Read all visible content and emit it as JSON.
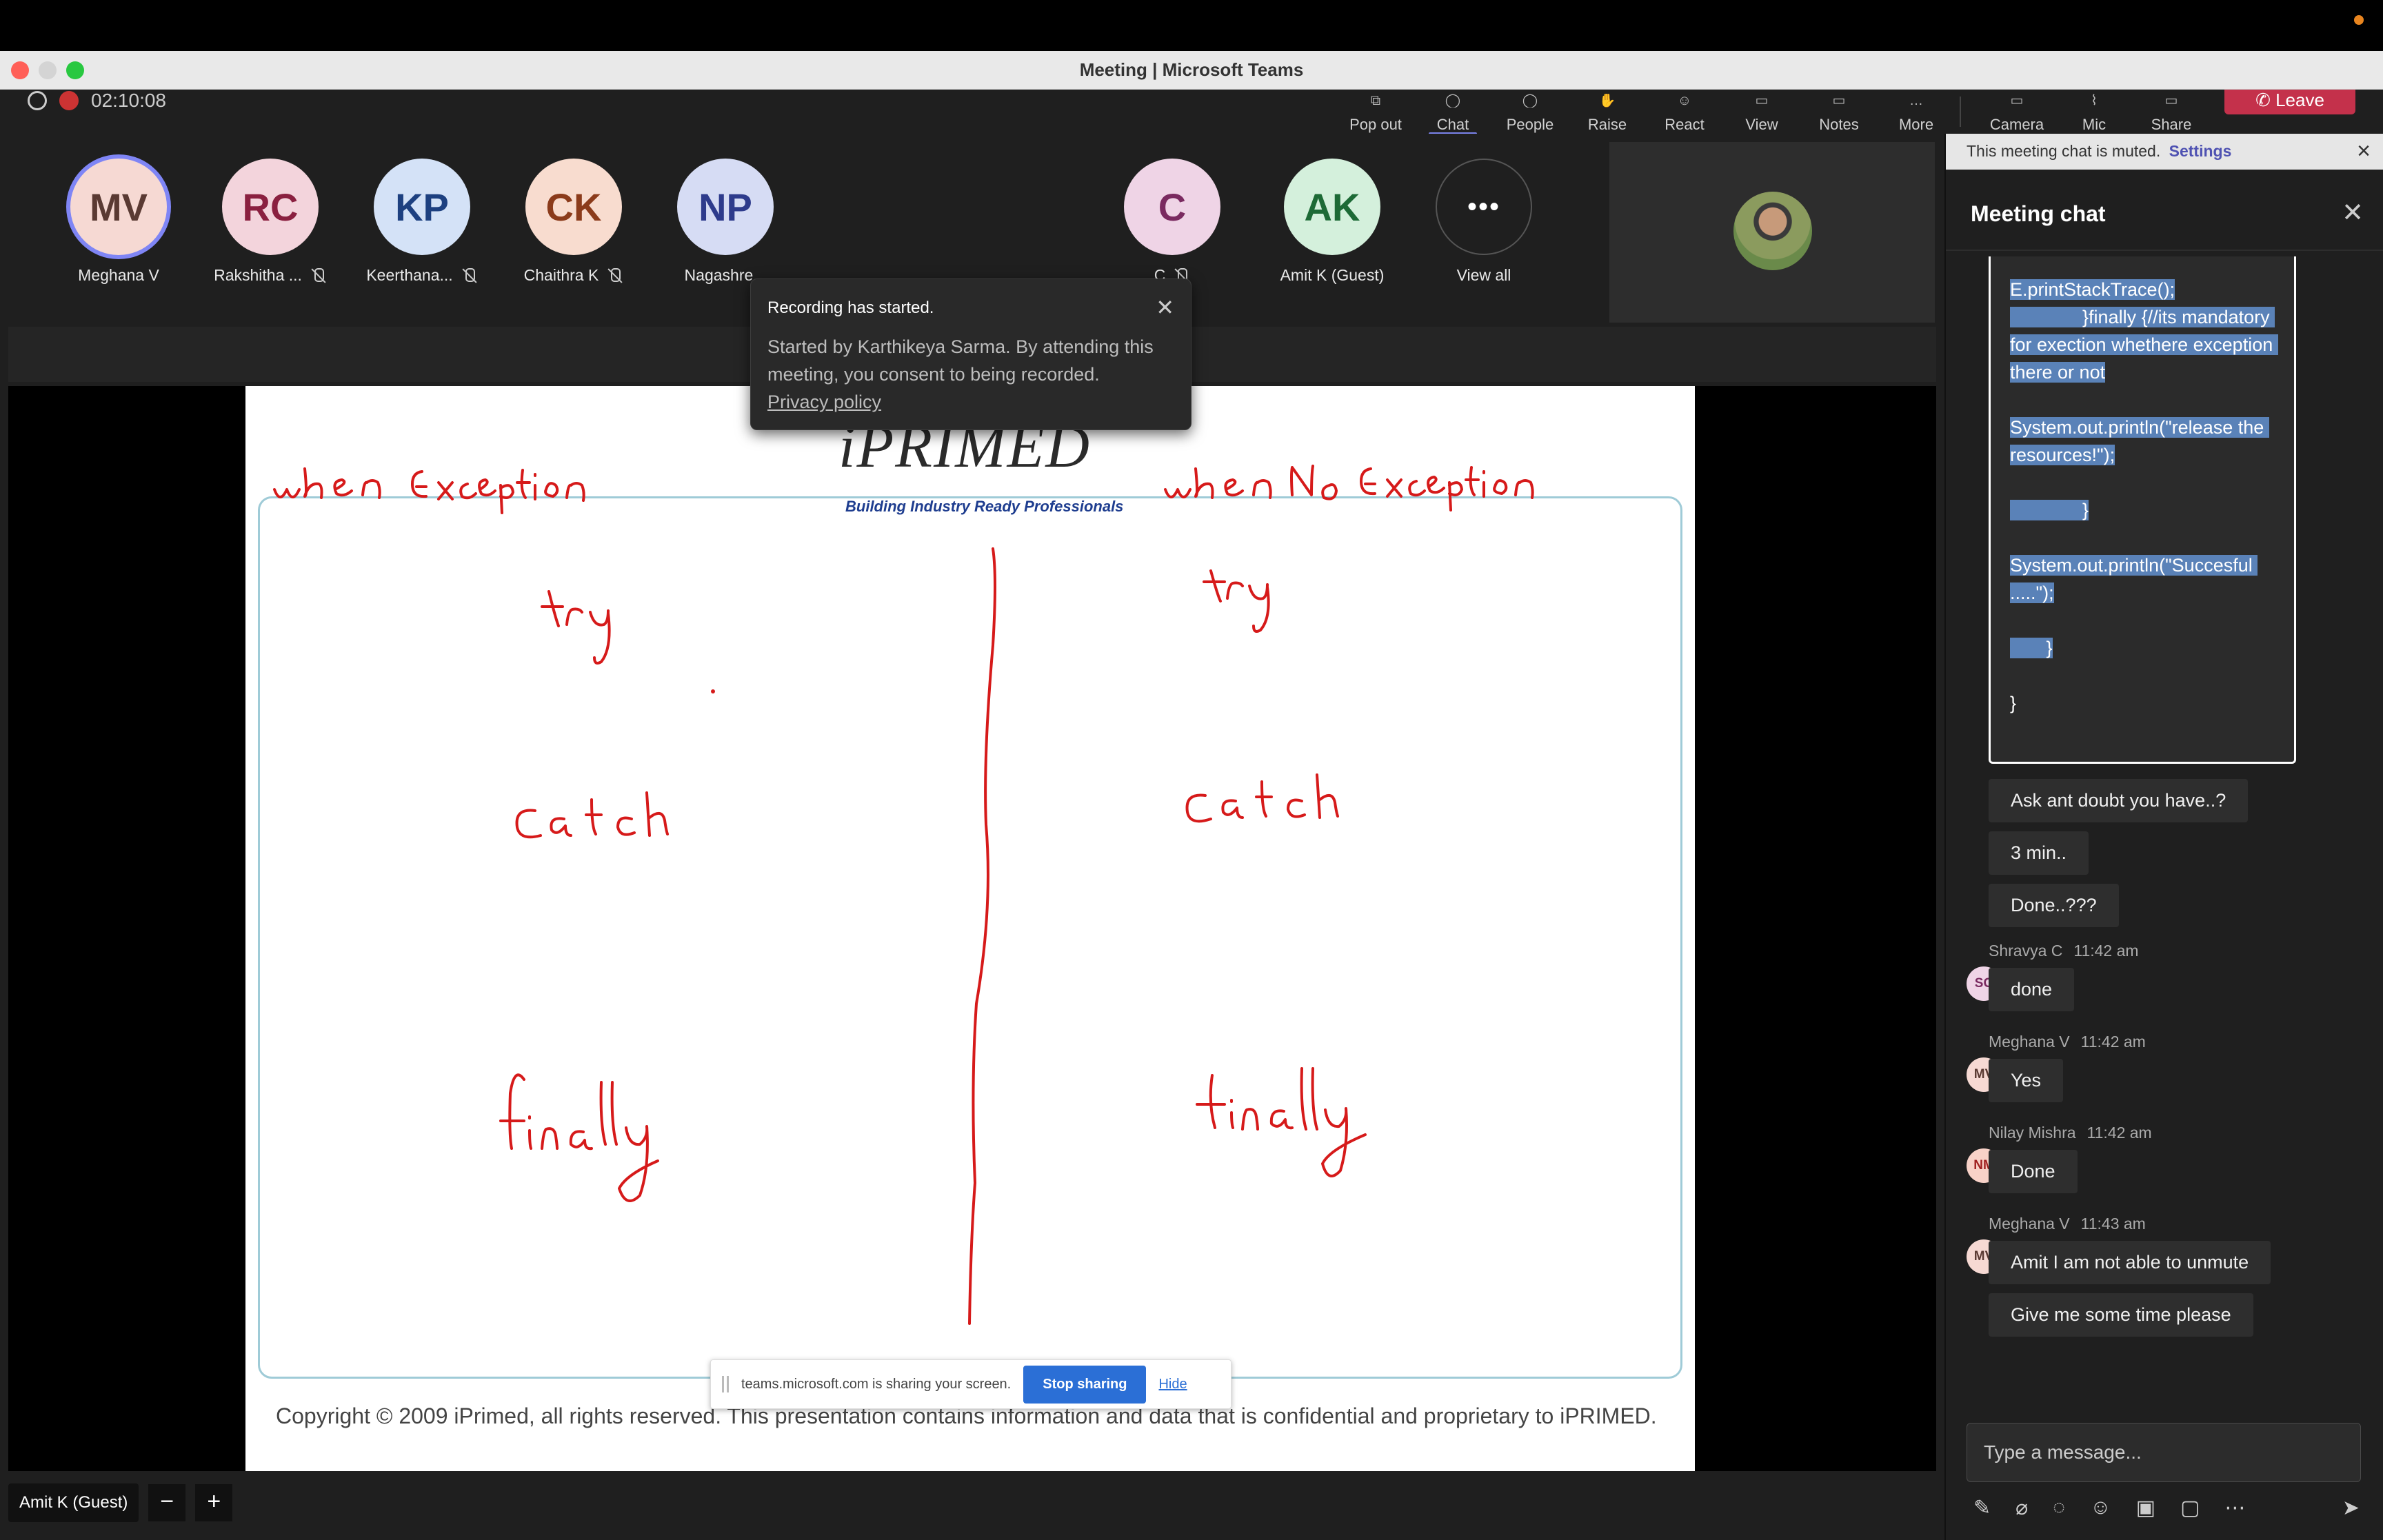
{
  "window": {
    "title": "Meeting | Microsoft Teams"
  },
  "toolbar": {
    "timer": "02:10:08",
    "buttons": [
      {
        "id": "popout",
        "label": "Pop out"
      },
      {
        "id": "chat",
        "label": "Chat"
      },
      {
        "id": "people",
        "label": "People"
      },
      {
        "id": "raise",
        "label": "Raise"
      },
      {
        "id": "react",
        "label": "React"
      },
      {
        "id": "view",
        "label": "View"
      },
      {
        "id": "notes",
        "label": "Notes"
      },
      {
        "id": "more",
        "label": "More"
      },
      {
        "id": "camera",
        "label": "Camera"
      },
      {
        "id": "mic",
        "label": "Mic"
      },
      {
        "id": "share",
        "label": "Share"
      }
    ],
    "leave_label": "Leave"
  },
  "participants": [
    {
      "initials": "MV",
      "name": "Meghana V",
      "bg": "#f6d9d3",
      "fg": "#5a3a33",
      "muted": false
    },
    {
      "initials": "RC",
      "name": "Rakshitha ...",
      "bg": "#f3d4dc",
      "fg": "#8a2040",
      "muted": true
    },
    {
      "initials": "KP",
      "name": "Keerthana...",
      "bg": "#d4e2f7",
      "fg": "#1d4080",
      "muted": true
    },
    {
      "initials": "CK",
      "name": "Chaithra K",
      "bg": "#f8dccf",
      "fg": "#8b3b1b",
      "muted": true
    },
    {
      "initials": "NP",
      "name": "Nagashre...",
      "bg": "#d6dcf4",
      "fg": "#2e3b8c",
      "muted": false
    },
    {
      "initials": "C",
      "name": "C",
      "bg": "#efd4e6",
      "fg": "#7a2a60",
      "muted": true
    },
    {
      "initials": "AK",
      "name": "Amit K (Guest)",
      "bg": "#d4f0dc",
      "fg": "#1d6a36",
      "muted": false
    }
  ],
  "view_all_label": "View all",
  "recording_toast": {
    "title": "Recording has started.",
    "body": "Started by Karthikeya Sarma. By attending this meeting, you consent to being recorded.",
    "policy_link": "Privacy policy"
  },
  "slide": {
    "logo": "iPRIMED",
    "tagline": "Building Industry Ready Professionals",
    "footer": "Copyright © 2009 iPrimed, all rights reserved. This presentation contains information  and data  that is confidential and proprietary to iPRIMED."
  },
  "sharing_bar": {
    "text": "teams.microsoft.com is sharing your screen.",
    "stop_label": "Stop sharing",
    "hide_label": "Hide"
  },
  "bottom_bar": {
    "name": "Amit K (Guest)",
    "zoom_out": "−",
    "zoom_in": "+"
  },
  "chat": {
    "muted_text": "This meeting chat is muted.",
    "muted_settings": "Settings",
    "title": "Meeting chat",
    "code_message": [
      "E.printStackTrace();",
      "              }finally {//its mandatory for exection whethere exception there or not",
      "",
      "System.out.println(\"release the resources!\");",
      "",
      "              }",
      "",
      "System.out.println(\"Succesful .....\");",
      "",
      "       }",
      "",
      "}"
    ],
    "bubbles_plain": [
      "Ask ant doubt you have..?",
      "3 min..",
      "Done..???"
    ],
    "messages": [
      {
        "sender": "Shravya C",
        "time": "11:42 am",
        "initials": "SC",
        "bg": "#efd4e6",
        "fg": "#7a2a60",
        "text": "done"
      },
      {
        "sender": "Meghana V",
        "time": "11:42 am",
        "initials": "MV",
        "bg": "#f6d9d3",
        "fg": "#5a3a33",
        "text": "Yes"
      },
      {
        "sender": "Nilay Mishra",
        "time": "11:42 am",
        "initials": "NM",
        "bg": "#f8d2c8",
        "fg": "#a02020",
        "text": "Done"
      },
      {
        "sender": "Meghana V",
        "time": "11:43 am",
        "initials": "MV",
        "bg": "#f6d9d3",
        "fg": "#5a3a33",
        "text": "Amit I am not able to unmute"
      }
    ],
    "followup": "Give me some time please",
    "compose_placeholder": "Type a message..."
  }
}
